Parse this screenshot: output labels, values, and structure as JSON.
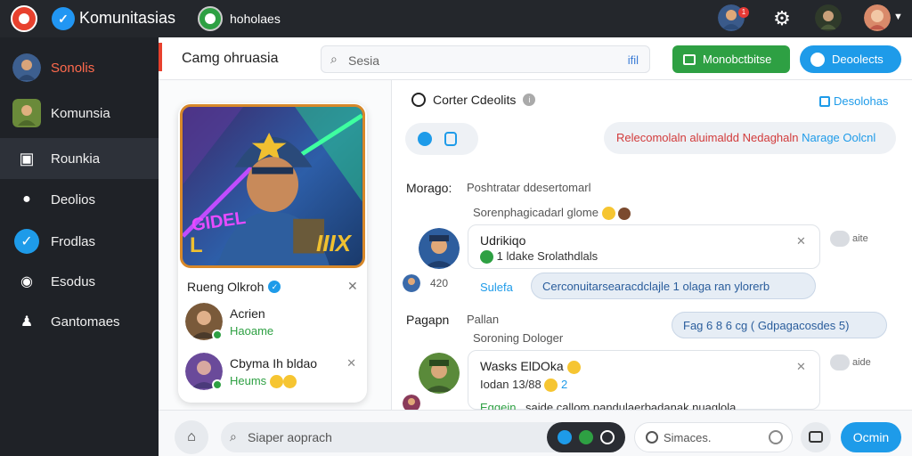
{
  "topbar": {
    "app_title": "Komunitasias",
    "nav_label": "hoholaes",
    "notif_count": "1"
  },
  "sidebar": {
    "items": [
      {
        "label": "Sonolis"
      },
      {
        "label": "Komunsia"
      },
      {
        "label": "Rounkia"
      },
      {
        "label": "Deolios"
      },
      {
        "label": "Frodlas"
      },
      {
        "label": "Esodus"
      },
      {
        "label": "Gantomaes"
      }
    ]
  },
  "header": {
    "title": "Camg ohruasia",
    "search_placeholder": "Sesia",
    "search_hint": "ifil",
    "green_button": "Monobctbitse",
    "blue_button": "Deoolects"
  },
  "card": {
    "art_text_left": "GIDEL",
    "art_text_right": "IIIX",
    "art_badge": "L",
    "title": "Rueng Olkroh",
    "friends": [
      {
        "name": "Acrien",
        "status": "Haoame"
      },
      {
        "name": "Cbyma Ih bldao",
        "status": "Heums"
      }
    ]
  },
  "chat": {
    "title": "Corter Cdeolits",
    "link": "Desolohas",
    "banner_red": "Relecomolaln aluimaldd Nedaghaln",
    "banner_blue": "Narage Oolcnl",
    "label_1": "Morago:",
    "label_1_sub": "Poshtratar ddesertomarl",
    "line_1": "Sorenphagicadarl glome",
    "msg_1": {
      "title": "Udrikiqo",
      "sub": "1 ldake Srolathdlals",
      "toggle": "aite"
    },
    "tiny_label": "420",
    "link_1": "Sulefa",
    "chip_1": "Cerconuitarsearacdclajle 1 olaga ran ylorerb",
    "label_2": "Pagapn",
    "label_2_sub": "Pallan",
    "chip_2": "Fag 6 8 6 cg ( Gdpagacosdes 5)",
    "line_2": "Soroning Dologer",
    "msg_2": {
      "title": "Wasks ElDOka",
      "sub": "Iodan 13/88",
      "sub_num": "2",
      "toggle": "aide"
    },
    "link_2": "Eggein",
    "truncated_line": "saide callom pandulaerbadanak nuaglola"
  },
  "bottom": {
    "search_placeholder": "Siaper aoprach",
    "message_placeholder": "Simaces.",
    "send_label": "Ocmin"
  },
  "colors": {
    "accent_red": "#e8412e",
    "brand_blue": "#1e9be9",
    "success_green": "#2ea043",
    "sidebar_bg": "#1f2227"
  }
}
